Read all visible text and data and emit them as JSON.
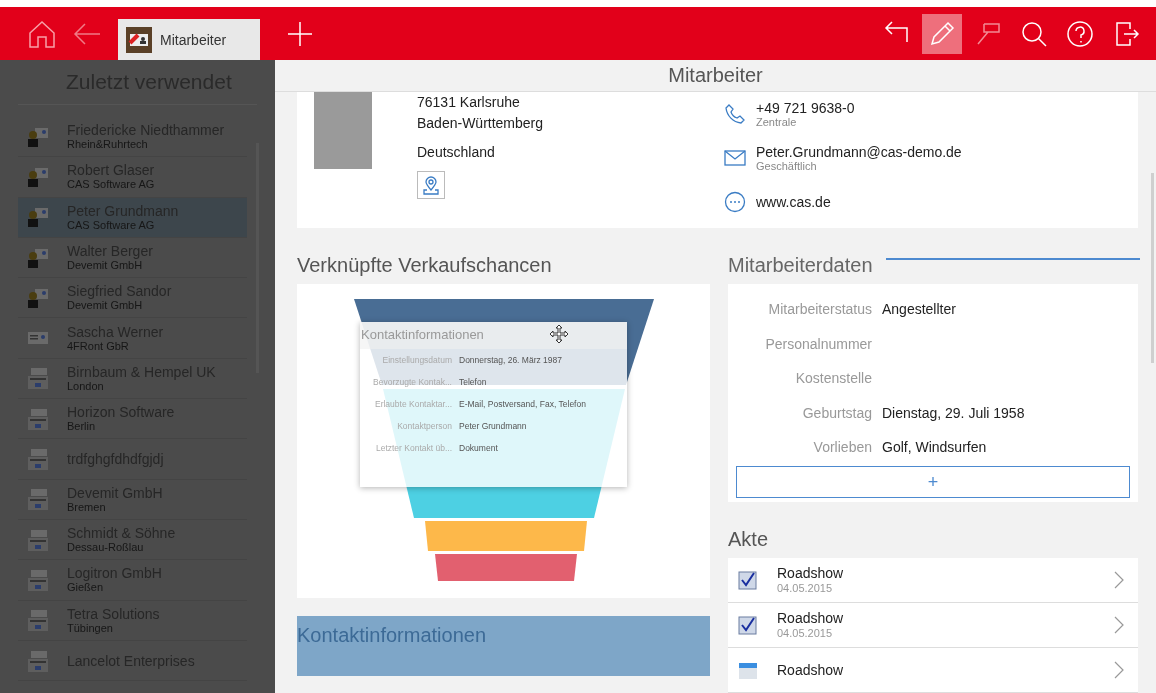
{
  "topbar": {
    "tab": {
      "label": "Mitarbeiter",
      "selected": true
    },
    "tools": [
      {
        "kind": "undo",
        "active": false,
        "disabled": false
      },
      {
        "kind": "edit",
        "active": true,
        "disabled": false
      },
      {
        "kind": "pin",
        "active": false,
        "disabled": true
      },
      {
        "kind": "search",
        "active": false,
        "disabled": false
      },
      {
        "kind": "help",
        "active": false,
        "disabled": false
      },
      {
        "kind": "exit",
        "active": false,
        "disabled": false
      }
    ]
  },
  "sidebar": {
    "title": "Zuletzt verwendet",
    "items": [
      {
        "name": "Friedericke Niedthammer",
        "sub": "Rhein&Ruhrtech",
        "kind": "person",
        "selected": false
      },
      {
        "name": "Robert Glaser",
        "sub": "CAS Software AG",
        "kind": "person",
        "selected": false
      },
      {
        "name": "Peter Grundmann",
        "sub": "CAS Software AG",
        "kind": "person",
        "selected": true
      },
      {
        "name": "Walter Berger",
        "sub": "Devemit GmbH",
        "kind": "person",
        "selected": false
      },
      {
        "name": "Siegfried Sandor",
        "sub": "Devemit GmbH",
        "kind": "person",
        "selected": false
      },
      {
        "name": "Sascha Werner",
        "sub": "4FRont GbR",
        "kind": "card",
        "selected": false
      },
      {
        "name": "Birnbaum & Hempel UK",
        "sub": "London",
        "kind": "company",
        "selected": false
      },
      {
        "name": "Horizon Software",
        "sub": "Berlin",
        "kind": "company",
        "selected": false
      },
      {
        "name": "trdfghgfdhdfgjdj",
        "kind": "company",
        "selected": false
      },
      {
        "name": "Devemit GmbH",
        "sub": "Bremen",
        "kind": "company",
        "selected": false
      },
      {
        "name": "Schmidt & Söhne",
        "sub": "Dessau-Roßlau",
        "kind": "company",
        "selected": false
      },
      {
        "name": "Logitron GmbH",
        "sub": "Gießen",
        "kind": "company",
        "selected": false
      },
      {
        "name": "Tetra Solutions",
        "sub": "Tübingen",
        "kind": "company",
        "selected": false
      },
      {
        "name": "Lancelot Enterprises",
        "kind": "company",
        "selected": false
      }
    ]
  },
  "main": {
    "title": "Mitarbeiter",
    "address": [
      "76131 Karlsruhe",
      "Baden-Württemberg",
      "Deutschland"
    ],
    "contacts": [
      {
        "kind": "phone",
        "value": "+49 721 9638-0",
        "sub": "Zentrale"
      },
      {
        "kind": "mail",
        "value": "Peter.Grundmann@cas-demo.de",
        "sub": "Geschäftlich"
      },
      {
        "kind": "web",
        "value": "www.cas.de"
      }
    ],
    "opportunities_title": "Verknüpfte Verkaufschancen",
    "contact_info_title": "Kontaktinformationen",
    "employee": {
      "title": "Mitarbeiterdaten",
      "fields": [
        {
          "label": "Mitarbeiterstatus",
          "value": "Angestellter"
        },
        {
          "label": "Personalnummer"
        },
        {
          "label": "Kostenstelle"
        },
        {
          "label": "Geburtstag",
          "value": "Dienstag, 29. Juli 1958"
        },
        {
          "label": "Vorlieben",
          "value": "Golf, Windsurfen"
        }
      ],
      "add": "+"
    },
    "files": {
      "title": "Akte",
      "items": [
        {
          "kind": "task",
          "title": "Roadshow",
          "date": "04.05.2015"
        },
        {
          "kind": "task",
          "title": "Roadshow",
          "date": "04.05.2015"
        },
        {
          "kind": "appointment",
          "title": "Roadshow"
        }
      ]
    },
    "drag_ghost": {
      "title": "Kontaktinformationen",
      "rows": [
        {
          "label": "Einstellungsdatum",
          "value": "Donnerstag, 26. März 1987"
        },
        {
          "label": "Bevorzugte Kontak...",
          "value": "Telefon"
        },
        {
          "label": "Erlaubte Kontaktar...",
          "value": "E-Mail, Postversand, Fax, Telefon"
        },
        {
          "label": "Kontaktperson",
          "value": "Peter Grundmann"
        },
        {
          "label": "Letzter Kontakt üb...",
          "value": "Dokument"
        }
      ]
    }
  }
}
